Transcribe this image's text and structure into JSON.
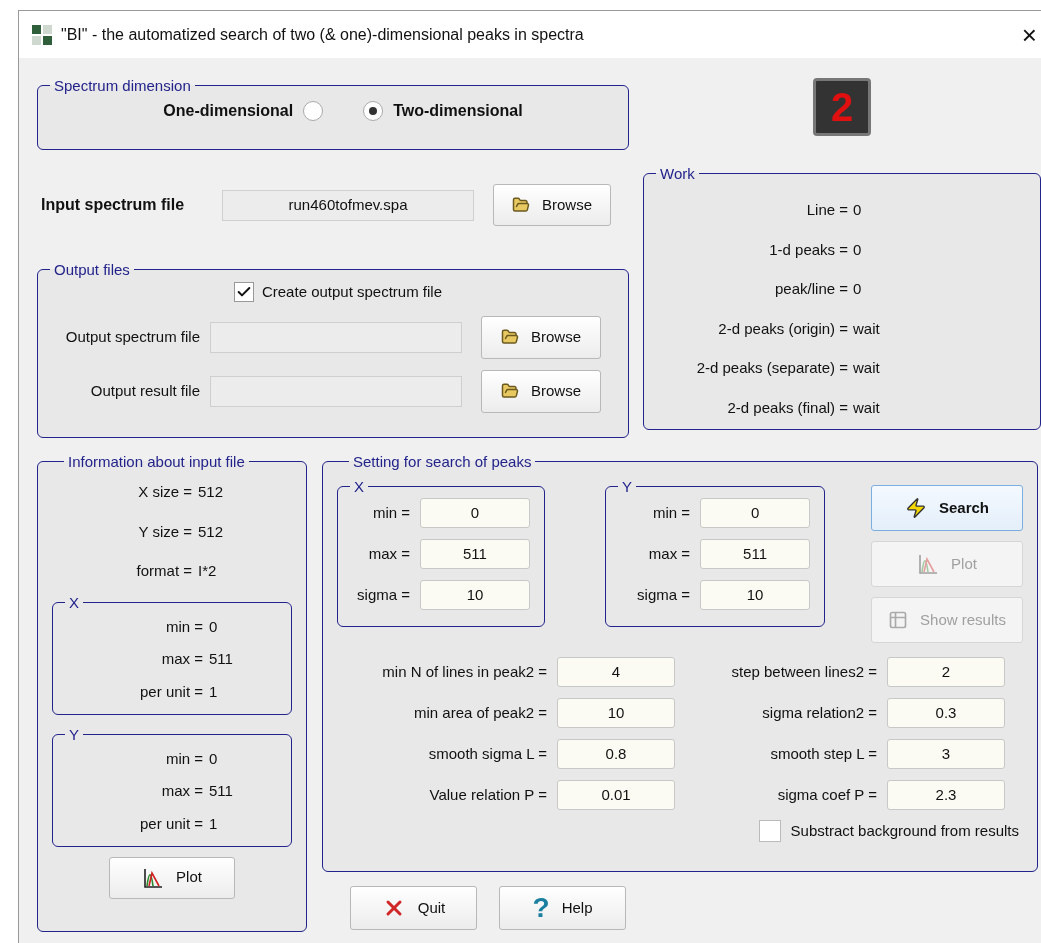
{
  "window": {
    "title": "\"BI\" - the automatized search of two (& one)-dimensional peaks in spectra",
    "close": "×"
  },
  "logo": {
    "badge": "2"
  },
  "spectrum_dimension": {
    "title": "Spectrum dimension",
    "options": [
      {
        "label": "One-dimensional",
        "selected": false
      },
      {
        "label": "Two-dimensional",
        "selected": true
      }
    ]
  },
  "input": {
    "label": "Input spectrum file",
    "value": "run460tofmev.spa",
    "browse": "Browse"
  },
  "output_files": {
    "title": "Output files",
    "create_checkbox": {
      "label": "Create output spectrum file",
      "checked": true
    },
    "fields": [
      {
        "label": "Output spectrum file",
        "browse": "Browse"
      },
      {
        "label": "Output result file",
        "browse": "Browse"
      }
    ]
  },
  "work": {
    "title": "Work",
    "rows": [
      {
        "label": "Line =",
        "value": "0"
      },
      {
        "label": "1-d peaks =",
        "value": "0"
      },
      {
        "label": "peak/line =",
        "value": "0"
      },
      {
        "label": "2-d peaks (origin) =",
        "value": "wait"
      },
      {
        "label": "2-d peaks (separate) =",
        "value": "wait"
      },
      {
        "label": "2-d peaks (final) =",
        "value": "wait"
      }
    ]
  },
  "info": {
    "title": "Information about input file",
    "rows": [
      {
        "label": "X size =",
        "value": "512"
      },
      {
        "label": "Y size =",
        "value": "512"
      },
      {
        "label": "format =",
        "value": "I*2"
      }
    ],
    "axes": [
      {
        "title": "X",
        "rows": [
          {
            "label": "min =",
            "value": "0"
          },
          {
            "label": "max =",
            "value": "511"
          },
          {
            "label": "per unit =",
            "value": "1"
          }
        ]
      },
      {
        "title": "Y",
        "rows": [
          {
            "label": "min =",
            "value": "0"
          },
          {
            "label": "max =",
            "value": "511"
          },
          {
            "label": "per unit =",
            "value": "1"
          }
        ]
      }
    ],
    "plot": "Plot"
  },
  "settings": {
    "title": "Setting for search of peaks",
    "axes": [
      {
        "title": "X",
        "fields": [
          {
            "label": "min =",
            "value": "0"
          },
          {
            "label": "max =",
            "value": "511"
          },
          {
            "label": "sigma =",
            "value": "10"
          }
        ]
      },
      {
        "title": "Y",
        "fields": [
          {
            "label": "min =",
            "value": "0"
          },
          {
            "label": "max =",
            "value": "511"
          },
          {
            "label": "sigma =",
            "value": "10"
          }
        ]
      }
    ],
    "buttons": [
      {
        "kind": "search",
        "label": "Search",
        "disabled": false
      },
      {
        "kind": "plot",
        "label": "Plot",
        "disabled": true
      },
      {
        "kind": "results",
        "label": "Show results",
        "disabled": true
      }
    ],
    "params": [
      {
        "label": "min N of lines in peak2 =",
        "value": "4"
      },
      {
        "label": "step between lines2 =",
        "value": "2"
      },
      {
        "label": "min area of peak2 =",
        "value": "10"
      },
      {
        "label": "sigma relation2 =",
        "value": "0.3"
      },
      {
        "label": "smooth sigma L =",
        "value": "0.8"
      },
      {
        "label": "smooth step L =",
        "value": "3"
      },
      {
        "label": "Value relation P =",
        "value": "0.01"
      },
      {
        "label": "sigma coef P =",
        "value": "2.3"
      }
    ],
    "subtract_checkbox": {
      "label": "Substract background from results",
      "checked": false
    }
  },
  "buttons": [
    {
      "kind": "quit",
      "label": "Quit"
    },
    {
      "kind": "help",
      "label": "Help",
      "icon": "?"
    }
  ]
}
